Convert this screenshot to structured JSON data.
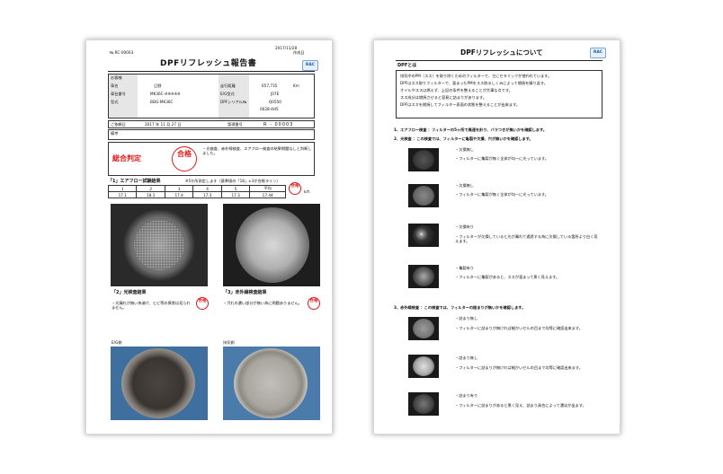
{
  "left_page": {
    "report_no": "№ RC-00003",
    "created_date": "2017/11/28",
    "created_label": "作成日",
    "title": "DPFリフレッシュ報告書",
    "logo_text": "RAC",
    "customer_label": "お客様",
    "car_name_label": "車名",
    "car_name_value": "日野",
    "model_label": "車台番号",
    "model_value": "MK36C-※※※※※",
    "type_label": "型式",
    "type_value": "BDG-MK36C",
    "mileage_label": "走行距離",
    "mileage_value": "657,735",
    "mileage_unit": "Km",
    "eg_type_label": "E/G型式",
    "eg_type_value": "J07E",
    "dpf_serial_label": "DPFシリアル№",
    "dpf_serial_value": "Q0550",
    "dpf_serial_sub": "0028-4H5",
    "delivery_label": "ご依頼日",
    "delivery_date": "2017 年 11 月 27 日",
    "manage_label": "管理番号",
    "manage_value": "R - 00003",
    "remarks_label": "備考",
    "overall_label": "総合判定",
    "pass_stamp": "合格",
    "overall_note": "・光検査、赤外線検査、エアフロー検査の結果問題なしと判断しました。",
    "airflow_title": "「1」エアフロー試験結果",
    "airflow_note": "※5か所測定します（基準値の「18」±3が合格ライン）",
    "airflow_headers": [
      "1",
      "2",
      "3",
      "4",
      "5",
      "平均"
    ],
    "airflow_values": [
      "17.1",
      "18.1",
      "17.4",
      "17.3",
      "17.3",
      "17.44"
    ],
    "airflow_unit": "k/h",
    "light_title": "「2」光検査結果",
    "light_note": "・光漏れが無い為溶け、ヒビ等の異常は見られません。",
    "ir_title": "「3」赤外線検査結果",
    "ir_note": "・汚れの濃い部分が無い為に問題ありません。",
    "eg_side_label": "E/G側",
    "exhaust_side_label": "排気側"
  },
  "right_page": {
    "title": "DPFリフレッシュについて",
    "logo_text": "RAC",
    "what_is_label": "DPFとは",
    "intro_lines": [
      "排気中のPM（スス）を取り除くためのフィルターで、主にセラミックが使われています。",
      "DPFはスス取りフィルターで、溜まったPMをスス取るしくみによって燃焼を繰り返す。",
      "オイルやススは燃えず、上記の条件を整えることが大事な点です。",
      "スス成分は燃焼させると容易に詰まりがあります。",
      "DPFはススを燃焼してフィルター表面の状態を整えることが出来ます。"
    ],
    "step1": "1、エアフロー検査 ：フィルターの5ヶ所で風速を計り、バラつきが無いかを確認します。",
    "step2": "2、光検査 ：この検査では、フィルターに亀裂や欠損、穴が無いかを確認します。",
    "light_items": [
      {
        "label": "・欠損無し",
        "desc": "・フィルターに亀裂が無く全体が均一に光っています。"
      },
      {
        "label": "・欠損無し",
        "desc": "・フィルターに亀裂が無く全体が均一に光っています。"
      },
      {
        "label": "・欠損有り",
        "desc": "・フィルターが欠損していると光が漏れて通過する為に欠損している箇所より白く見えます。"
      },
      {
        "label": "・亀裂有り",
        "desc": "・フィルターに亀裂があると、ススが溜まって黒く見えます。"
      }
    ],
    "step3": "3、赤外線検査 ：この検査では、フィルターの詰まりが無いかを確認します。",
    "ir_items": [
      {
        "label": "・詰まり無し",
        "desc": "・フィルターに詰まりが無ければ細かいセルの目まで均等に確認出来ます。"
      },
      {
        "label": "・詰まり無し",
        "desc": "・フィルターに詰まりが無ければ細かいセルの目まで均等に確認出来ます。"
      },
      {
        "label": "・詰まり有り",
        "desc": "・フィルターに詰まりがあると黒く見え、詰まり具合によって濃淡が出ます。"
      }
    ]
  }
}
